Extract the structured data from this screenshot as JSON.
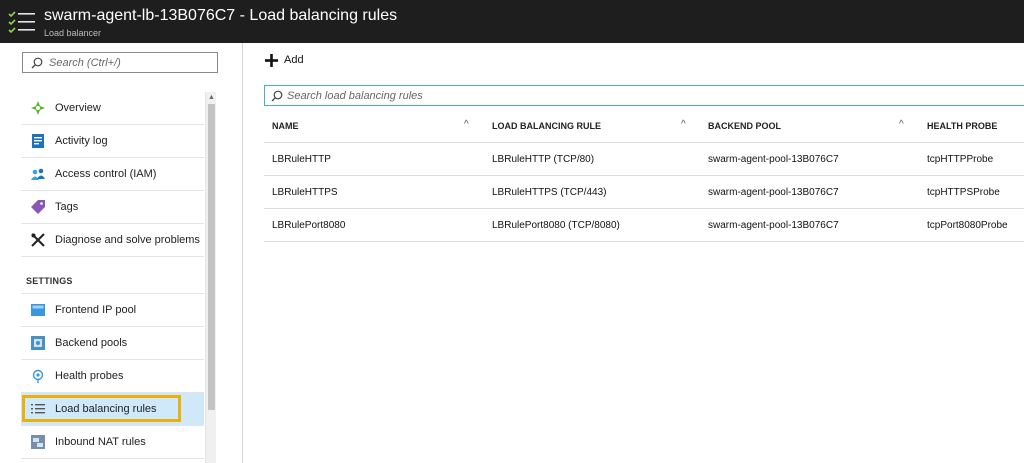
{
  "header": {
    "title": "swarm-agent-lb-13B076C7 - Load balancing rules",
    "subtitle": "Load balancer",
    "icon": "menu-checklist-icon"
  },
  "sidebar": {
    "search_placeholder": "Search (Ctrl+/)",
    "items": [
      {
        "label": "Overview",
        "icon": "overview-icon"
      },
      {
        "label": "Activity log",
        "icon": "activity-log-icon"
      },
      {
        "label": "Access control (IAM)",
        "icon": "access-control-icon"
      },
      {
        "label": "Tags",
        "icon": "tag-icon"
      },
      {
        "label": "Diagnose and solve problems",
        "icon": "wrench-icon"
      }
    ],
    "settings_header": "SETTINGS",
    "settings_items": [
      {
        "label": "Frontend IP pool",
        "icon": "frontend-ip-icon"
      },
      {
        "label": "Backend pools",
        "icon": "backend-pool-icon"
      },
      {
        "label": "Health probes",
        "icon": "health-probe-icon"
      },
      {
        "label": "Load balancing rules",
        "icon": "list-icon",
        "selected": true
      },
      {
        "label": "Inbound NAT rules",
        "icon": "nat-rules-icon"
      }
    ]
  },
  "toolbar": {
    "add_label": "Add"
  },
  "main": {
    "search_placeholder": "Search load balancing rules",
    "columns": [
      "NAME",
      "LOAD BALANCING RULE",
      "BACKEND POOL",
      "HEALTH PROBE"
    ],
    "rows": [
      [
        "LBRuleHTTP",
        "LBRuleHTTP (TCP/80)",
        "swarm-agent-pool-13B076C7",
        "tcpHTTPProbe"
      ],
      [
        "LBRuleHTTPS",
        "LBRuleHTTPS (TCP/443)",
        "swarm-agent-pool-13B076C7",
        "tcpHTTPSProbe"
      ],
      [
        "LBRulePort8080",
        "LBRulePort8080 (TCP/8080)",
        "swarm-agent-pool-13B076C7",
        "tcpPort8080Probe"
      ]
    ]
  },
  "colors": {
    "header_bg": "#1e1e1e",
    "selected_bg": "#cfe9fb",
    "highlight_border": "#e8b10f",
    "search_focus": "#42b0d6"
  }
}
